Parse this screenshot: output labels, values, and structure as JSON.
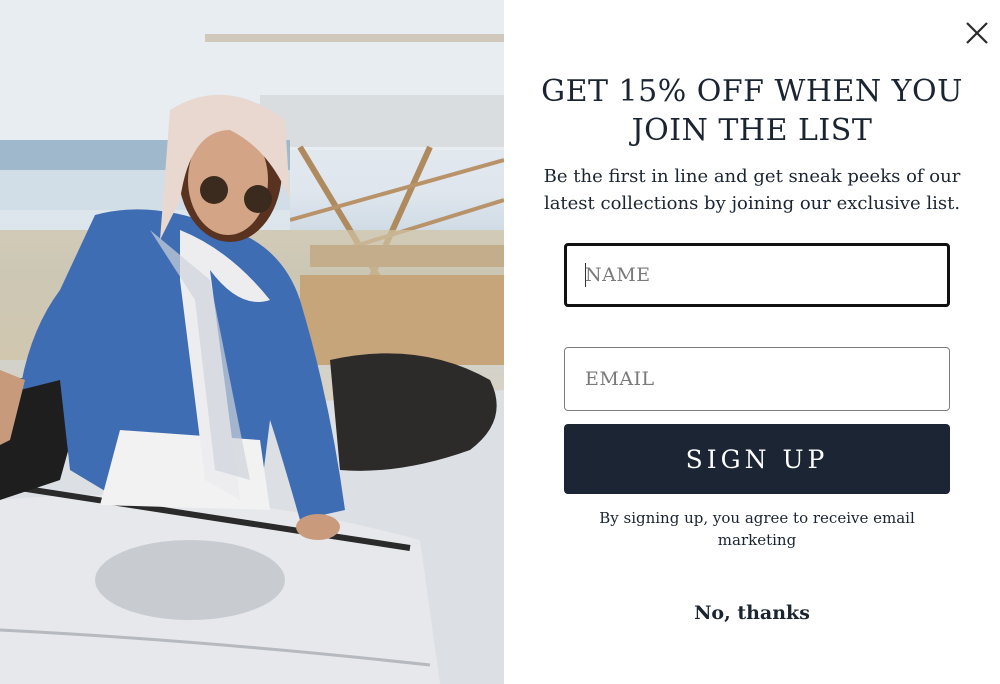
{
  "photo": {
    "alt_subject": "woman-in-headscarf-at-convertible"
  },
  "popup": {
    "close_icon": "close-icon",
    "headline_line1": "GET 15% OFF WHEN YOU",
    "headline_line2": "JOIN THE LIST",
    "subtext_line1": "Be the first in line and get sneak peeks of our",
    "subtext_line2": "latest collections by joining our exclusive list.",
    "name_field": {
      "placeholder": "NAME",
      "value": ""
    },
    "email_field": {
      "placeholder": "EMAIL",
      "value": ""
    },
    "signup_label": "SIGN UP",
    "disclaimer_line1": "By signing up, you agree to receive email",
    "disclaimer_line2": "marketing",
    "decline_label": "No, thanks"
  },
  "colors": {
    "text": "#1b2431",
    "button_bg": "#1b2533",
    "button_text": "#ffffff",
    "background": "#ffffff"
  }
}
